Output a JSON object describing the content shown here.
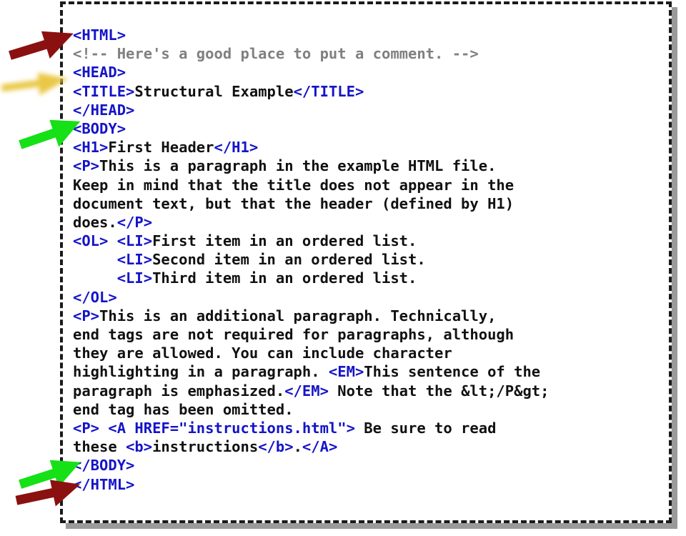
{
  "document": {
    "title": "Structural Example",
    "language": "HTML",
    "frame": {
      "border_style": "dashed",
      "border_color": "#1a1a1a",
      "shadow_color": "#9a9a9a",
      "background": "#ffffff"
    },
    "colors": {
      "tag": "#1414c8",
      "text": "#111111",
      "comment": "#808080",
      "arrow_red": "#8b1111",
      "arrow_green": "#16e016",
      "arrow_yellow": "#e8c438"
    }
  },
  "code_lines": [
    {
      "id": "line-1",
      "indent": 0,
      "segments": [
        {
          "kind": "tag",
          "text": "<HTML>"
        }
      ]
    },
    {
      "id": "line-2",
      "indent": 0,
      "segments": [
        {
          "kind": "comment",
          "text": "<!-- Here's a good place to put a comment. -->"
        }
      ]
    },
    {
      "id": "line-3",
      "indent": 0,
      "segments": [
        {
          "kind": "tag",
          "text": "<HEAD>"
        }
      ]
    },
    {
      "id": "line-4",
      "indent": 0,
      "segments": [
        {
          "kind": "tag",
          "text": "<TITLE>"
        },
        {
          "kind": "text",
          "text": "Structural Example"
        },
        {
          "kind": "tag",
          "text": "</TITLE>"
        }
      ]
    },
    {
      "id": "line-5",
      "indent": 0,
      "segments": [
        {
          "kind": "tag",
          "text": "</HEAD>"
        }
      ]
    },
    {
      "id": "line-6",
      "indent": 0,
      "segments": [
        {
          "kind": "tag",
          "text": "<BODY>"
        }
      ]
    },
    {
      "id": "line-7",
      "indent": 0,
      "segments": [
        {
          "kind": "tag",
          "text": "<H1>"
        },
        {
          "kind": "text",
          "text": "First Header"
        },
        {
          "kind": "tag",
          "text": "</H1>"
        }
      ]
    },
    {
      "id": "line-8",
      "indent": 0,
      "segments": [
        {
          "kind": "tag",
          "text": "<P>"
        },
        {
          "kind": "text",
          "text": "This is a paragraph in the example HTML file."
        }
      ]
    },
    {
      "id": "line-9",
      "indent": 0,
      "segments": [
        {
          "kind": "text",
          "text": "Keep in mind that the title does not appear in the"
        }
      ]
    },
    {
      "id": "line-10",
      "indent": 0,
      "segments": [
        {
          "kind": "text",
          "text": "document text, but that the header (defined by H1)"
        }
      ]
    },
    {
      "id": "line-11",
      "indent": 0,
      "segments": [
        {
          "kind": "text",
          "text": "does."
        },
        {
          "kind": "tag",
          "text": "</P>"
        }
      ]
    },
    {
      "id": "line-12",
      "indent": 0,
      "segments": [
        {
          "kind": "tag",
          "text": "<OL>"
        },
        {
          "kind": "text",
          "text": " "
        },
        {
          "kind": "tag",
          "text": "<LI>"
        },
        {
          "kind": "text",
          "text": "First item in an ordered list."
        }
      ]
    },
    {
      "id": "line-13",
      "indent": 5,
      "segments": [
        {
          "kind": "tag",
          "text": "<LI>"
        },
        {
          "kind": "text",
          "text": "Second item in an ordered list."
        }
      ]
    },
    {
      "id": "line-14",
      "indent": 5,
      "segments": [
        {
          "kind": "tag",
          "text": "<LI>"
        },
        {
          "kind": "text",
          "text": "Third item in an ordered list."
        }
      ]
    },
    {
      "id": "line-15",
      "indent": 0,
      "segments": [
        {
          "kind": "tag",
          "text": "</OL>"
        }
      ]
    },
    {
      "id": "line-16",
      "indent": 0,
      "segments": [
        {
          "kind": "tag",
          "text": "<P>"
        },
        {
          "kind": "text",
          "text": "This is an additional paragraph. Technically,"
        }
      ]
    },
    {
      "id": "line-17",
      "indent": 0,
      "segments": [
        {
          "kind": "text",
          "text": "end tags are not required for paragraphs, although"
        }
      ]
    },
    {
      "id": "line-18",
      "indent": 0,
      "segments": [
        {
          "kind": "text",
          "text": "they are allowed. You can include character"
        }
      ]
    },
    {
      "id": "line-19",
      "indent": 0,
      "segments": [
        {
          "kind": "text",
          "text": "highlighting in a paragraph. "
        },
        {
          "kind": "tag",
          "text": "<EM>"
        },
        {
          "kind": "text",
          "text": "This sentence of the"
        }
      ]
    },
    {
      "id": "line-20",
      "indent": 0,
      "segments": [
        {
          "kind": "text",
          "text": "paragraph is emphasized."
        },
        {
          "kind": "tag",
          "text": "</EM>"
        },
        {
          "kind": "text",
          "text": " Note that the &lt;/P&gt;"
        }
      ]
    },
    {
      "id": "line-21",
      "indent": 0,
      "segments": [
        {
          "kind": "text",
          "text": "end tag has been omitted."
        }
      ]
    },
    {
      "id": "line-22",
      "indent": 0,
      "segments": [
        {
          "kind": "tag",
          "text": "<P>"
        },
        {
          "kind": "text",
          "text": " "
        },
        {
          "kind": "tag",
          "text": "<A HREF=\"instructions.html\">"
        },
        {
          "kind": "text",
          "text": " Be sure to read"
        }
      ]
    },
    {
      "id": "line-23",
      "indent": 0,
      "segments": [
        {
          "kind": "text",
          "text": "these "
        },
        {
          "kind": "tag",
          "text": "<b>"
        },
        {
          "kind": "text",
          "text": "instructions"
        },
        {
          "kind": "tag",
          "text": "</b>"
        },
        {
          "kind": "text",
          "text": "."
        },
        {
          "kind": "tag",
          "text": "</A>"
        }
      ]
    },
    {
      "id": "line-24",
      "indent": 0,
      "segments": [
        {
          "kind": "tag",
          "text": "</BODY>"
        }
      ]
    },
    {
      "id": "line-25",
      "indent": 0,
      "segments": [
        {
          "kind": "tag",
          "text": "</HTML>"
        }
      ]
    }
  ],
  "annotations": [
    {
      "id": "arrow-html-open",
      "label": "red arrow pointing to <HTML> open tag",
      "color": "#8b1111",
      "target_line": "line-1"
    },
    {
      "id": "arrow-head-blur",
      "label": "blurred yellow arrow near <HEAD>",
      "color": "#e8c438",
      "target_line": "line-3"
    },
    {
      "id": "arrow-body-open",
      "label": "green arrow pointing to <BODY> open tag",
      "color": "#16e016",
      "target_line": "line-6"
    },
    {
      "id": "arrow-body-close",
      "label": "green arrow pointing to </BODY> close tag",
      "color": "#16e016",
      "target_line": "line-24"
    },
    {
      "id": "arrow-html-close",
      "label": "red arrow pointing to </HTML> close tag",
      "color": "#8b1111",
      "target_line": "line-25"
    }
  ]
}
